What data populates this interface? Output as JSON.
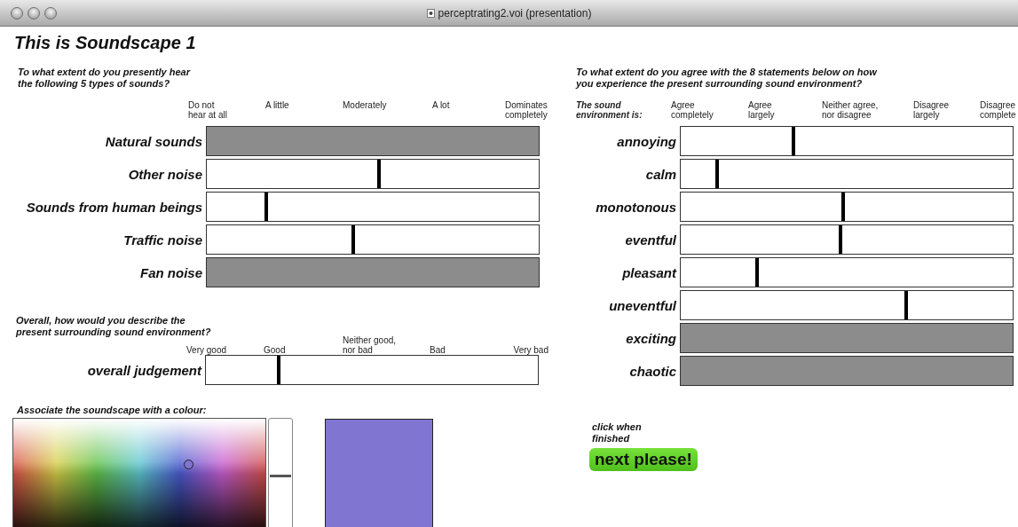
{
  "window": {
    "title": "perceptrating2.voi (presentation)"
  },
  "heading": "This is Soundscape 1",
  "sound_types": {
    "question": "To what extent do you presently hear\nthe following 5 types of sounds?",
    "scale": [
      "Do not\nhear at all",
      "A little",
      "Moderately",
      "A lot",
      "Dominates\ncompletely"
    ],
    "rows": [
      {
        "label": "Natural sounds",
        "disabled": true
      },
      {
        "label": "Other noise",
        "disabled": false,
        "level": 0.52
      },
      {
        "label": "Sounds from human beings",
        "disabled": false,
        "level": 0.18
      },
      {
        "label": "Traffic noise",
        "disabled": false,
        "level": 0.44
      },
      {
        "label": "Fan noise",
        "disabled": true
      }
    ]
  },
  "overall": {
    "question": "Overall, how would you describe the\npresent surrounding sound environment?",
    "scale": [
      "Very good",
      "Good",
      "Neither good,\nnor bad",
      "Bad",
      "Very bad"
    ],
    "rows": [
      {
        "label": "overall judgement",
        "disabled": false,
        "level": 0.22
      }
    ]
  },
  "colour": {
    "question": "Associate the soundscape with a colour:",
    "color": "#8075d0",
    "brightness": {
      "level": 0.55
    }
  },
  "statements": {
    "question": "To what extent do you agree with the 8 statements below on how\nyou experience the present surrounding sound environment?",
    "row_header": "The sound\nenvironment is:",
    "scale": [
      "Agree\ncompletely",
      "Agree\nlargely",
      "Neither agree,\nnor disagree",
      "Disagree\nlargely",
      "Disagree\ncomplete"
    ],
    "rows": [
      {
        "label": "annoying",
        "disabled": false,
        "level": 0.34
      },
      {
        "label": "calm",
        "disabled": false,
        "level": 0.11
      },
      {
        "label": "monotonous",
        "disabled": false,
        "level": 0.49
      },
      {
        "label": "eventful",
        "disabled": false,
        "level": 0.48
      },
      {
        "label": "pleasant",
        "disabled": false,
        "level": 0.23
      },
      {
        "label": "uneventful",
        "disabled": false,
        "level": 0.68
      },
      {
        "label": "exciting",
        "disabled": true
      },
      {
        "label": "chaotic",
        "disabled": true
      }
    ]
  },
  "finish": {
    "hint": "click when\nfinished",
    "button": "next please!"
  }
}
